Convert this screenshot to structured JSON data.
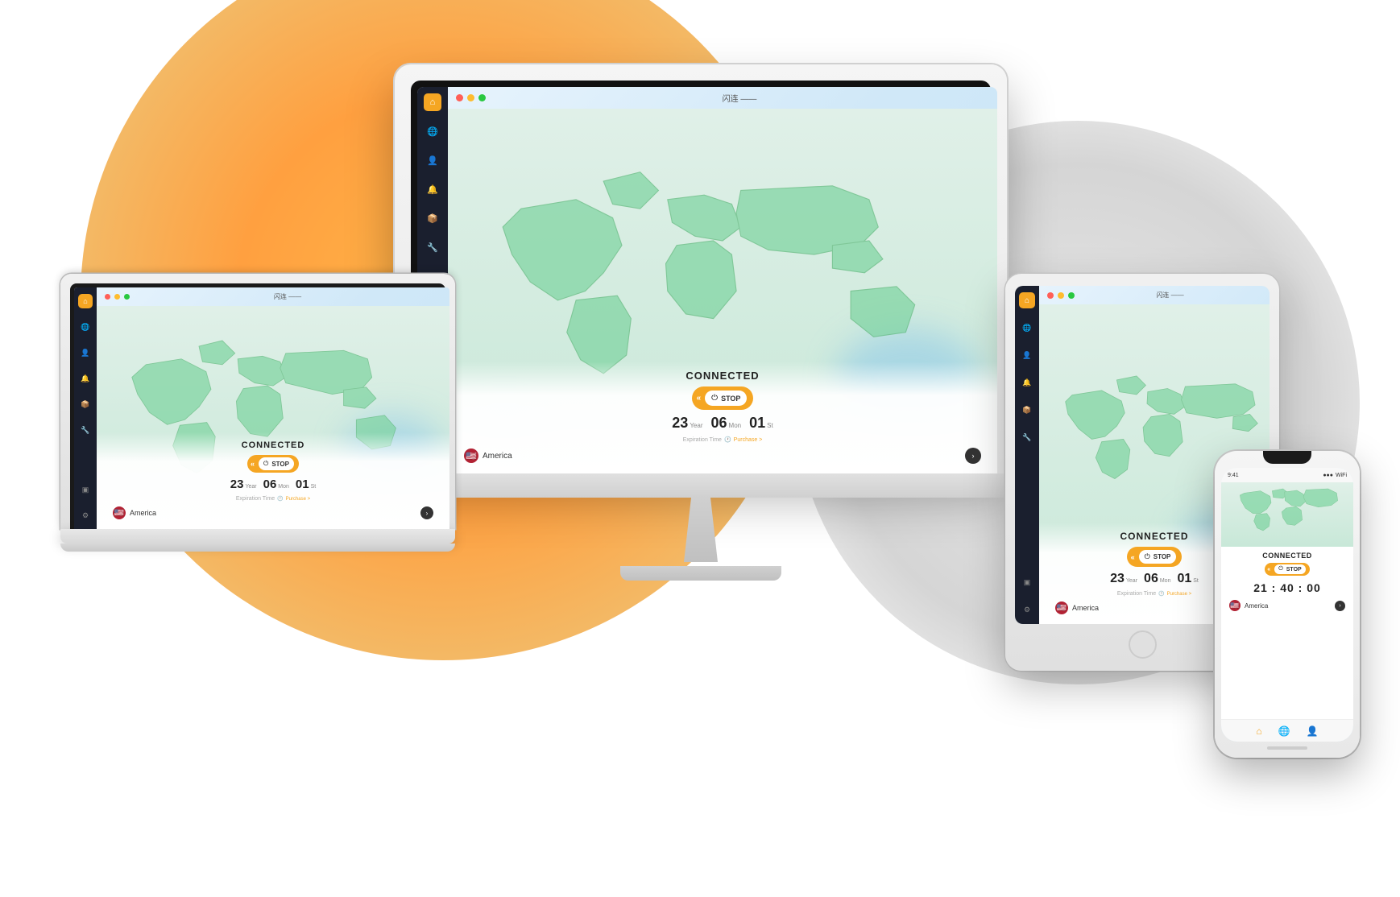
{
  "app": {
    "title": "闪连",
    "title_alt": "闪连 ——",
    "traffic_light_red": "close",
    "traffic_light_yellow": "minimize",
    "traffic_light_green": "fullscreen"
  },
  "vpn": {
    "status": "CONNECTED",
    "stop_btn": "STOP",
    "expiry": {
      "years": "23",
      "year_label": "Year",
      "months": "06",
      "month_label": "Mon",
      "days": "01",
      "day_label": "St"
    },
    "expiration_label": "Expiration Time",
    "purchase_label": "Purchase >",
    "location": "America",
    "timer": "21 : 40 : 00"
  },
  "phone": {
    "status": "CONNECTED",
    "stop_btn": "STOP",
    "location": "America",
    "timer": "21 : 40 : 00"
  },
  "sidebar": {
    "icons": [
      "home",
      "globe",
      "user",
      "bell",
      "package",
      "tool",
      "square",
      "settings"
    ]
  }
}
